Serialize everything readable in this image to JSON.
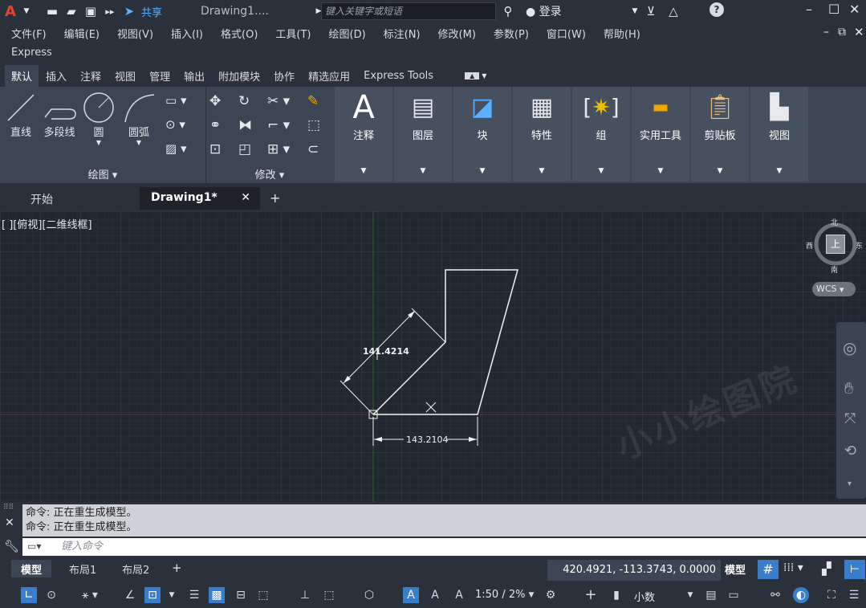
{
  "titlebar": {
    "share_label": "共享",
    "doc_title": "Drawing1....",
    "search_placeholder": "键入关键字或短语",
    "login_label": "登录"
  },
  "menu": {
    "items": [
      "文件(F)",
      "编辑(E)",
      "视图(V)",
      "插入(I)",
      "格式(O)",
      "工具(T)",
      "绘图(D)",
      "标注(N)",
      "修改(M)",
      "参数(P)",
      "窗口(W)",
      "帮助(H)"
    ],
    "express": "Express"
  },
  "ribbon_tabs": [
    "默认",
    "插入",
    "注释",
    "视图",
    "管理",
    "输出",
    "附加模块",
    "协作",
    "精选应用",
    "Express Tools"
  ],
  "draw_panel": {
    "title": "绘图 ▾",
    "line": "直线",
    "polyline": "多段线",
    "circle": "圆",
    "arc": "圆弧"
  },
  "modify_panel": {
    "title": "修改 ▾"
  },
  "big_panels": [
    "注释",
    "图层",
    "块",
    "特性",
    "组",
    "实用工具",
    "剪贴板",
    "视图"
  ],
  "doc_tabs": {
    "start": "开始",
    "drawing": "Drawing1*"
  },
  "viewport": {
    "label": "[ ][俯视][二维线框]",
    "dim1": "141.4214",
    "dim2": "143.2104",
    "watermark": "小小绘图院"
  },
  "viewcube": {
    "north": "北",
    "south": "南",
    "west": "西",
    "east": "东",
    "top": "上",
    "wcs": "WCS"
  },
  "command": {
    "lines": [
      "命令:   正在重生成模型。",
      "命令:   正在重生成模型。"
    ],
    "placeholder": "键入命令"
  },
  "layouts": [
    "模型",
    "布局1",
    "布局2"
  ],
  "status": {
    "coords": "420.4921, -113.3743, 0.0000",
    "model": "模型",
    "scale": "1:50 / 2%",
    "units": "小数"
  },
  "colors": {
    "accent": "#3a7ecb",
    "canvas_bg": "#212830",
    "ribbon_bg": "#3b4553"
  }
}
